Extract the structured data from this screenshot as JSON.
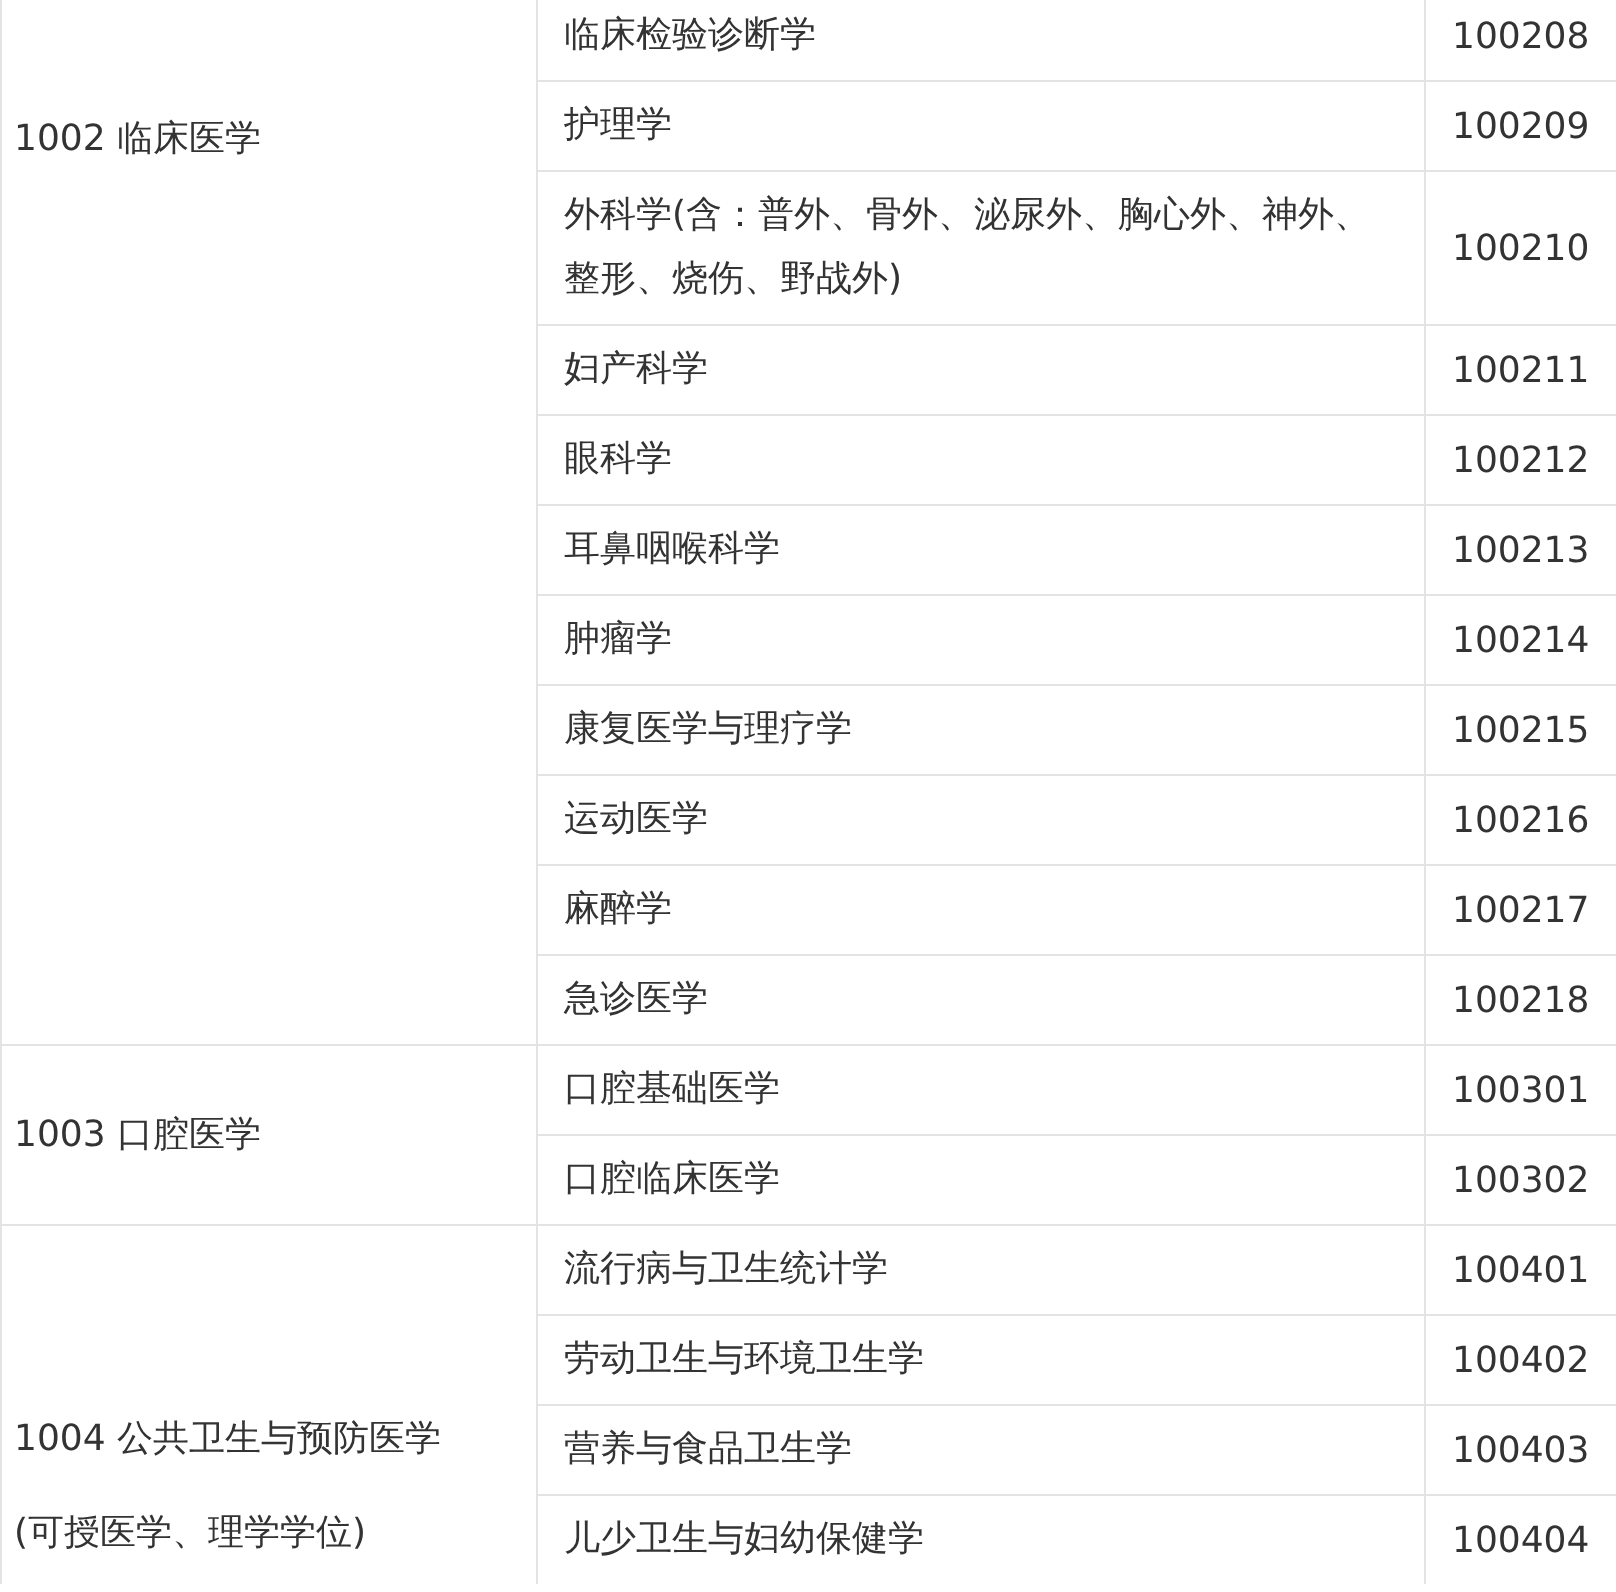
{
  "groups": [
    {
      "label_lines": [
        "1002 临床医学"
      ],
      "rows": [
        {
          "name": "临床检验诊断学",
          "code": "100208"
        },
        {
          "name": "护理学",
          "code": "100209"
        },
        {
          "name": "外科学(含：普外、骨外、泌尿外、胸心外、神外、整形、烧伤、野战外)",
          "code": "100210"
        },
        {
          "name": "妇产科学",
          "code": "100211"
        },
        {
          "name": "眼科学",
          "code": "100212"
        },
        {
          "name": "耳鼻咽喉科学",
          "code": "100213"
        },
        {
          "name": "肿瘤学",
          "code": "100214"
        },
        {
          "name": "康复医学与理疗学",
          "code": "100215"
        },
        {
          "name": "运动医学",
          "code": "100216"
        },
        {
          "name": "麻醉学",
          "code": "100217"
        },
        {
          "name": "急诊医学",
          "code": "100218"
        }
      ]
    },
    {
      "label_lines": [
        "1003 口腔医学"
      ],
      "rows": [
        {
          "name": "口腔基础医学",
          "code": "100301"
        },
        {
          "name": "口腔临床医学",
          "code": "100302"
        }
      ]
    },
    {
      "label_lines": [
        "1004 公共卫生与预防医学",
        "(可授医学、理学学位)"
      ],
      "rows": [
        {
          "name": "流行病与卫生统计学",
          "code": "100401"
        },
        {
          "name": "劳动卫生与环境卫生学",
          "code": "100402"
        },
        {
          "name": "营养与食品卫生学",
          "code": "100403"
        },
        {
          "name": "儿少卫生与妇幼保健学",
          "code": "100404"
        }
      ]
    }
  ]
}
